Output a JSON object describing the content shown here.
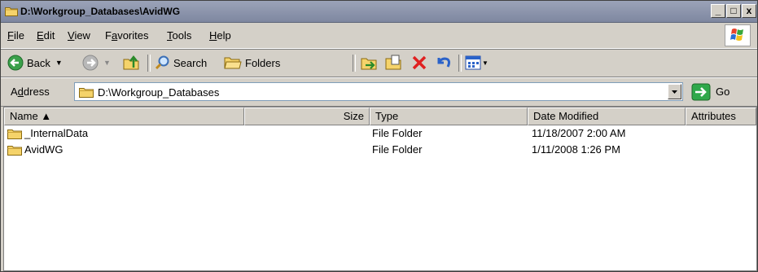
{
  "window": {
    "title": "D:\\Workgroup_Databases\\AvidWG",
    "controls": {
      "minimize": "_",
      "maximize": "□",
      "close": "x"
    }
  },
  "menubar": {
    "items": [
      {
        "label": "File",
        "accel": "F",
        "rest": "ile"
      },
      {
        "label": "Edit",
        "accel": "E",
        "rest": "dit"
      },
      {
        "label": "View",
        "accel": "V",
        "rest": "iew"
      },
      {
        "label": "Favorites",
        "pre": "F",
        "accel": "a",
        "rest": "vorites"
      },
      {
        "label": "Tools",
        "accel": "T",
        "rest": "ools"
      },
      {
        "label": "Help",
        "accel": "H",
        "rest": "elp"
      }
    ]
  },
  "toolbar": {
    "back_label": "Back",
    "search_label": "Search",
    "folders_label": "Folders",
    "icons": [
      "back-icon",
      "forward-icon",
      "up-folder-icon",
      "search-icon",
      "folders-icon",
      "move-to-icon",
      "copy-to-icon",
      "delete-icon",
      "undo-icon",
      "views-icon"
    ]
  },
  "address": {
    "label_pre": "A",
    "label_accel": "d",
    "label_rest": "dress",
    "value": "D:\\Workgroup_Databases",
    "go_label": "Go"
  },
  "columns": [
    {
      "label": "Name ▲"
    },
    {
      "label": "Size"
    },
    {
      "label": "Type"
    },
    {
      "label": "Date Modified"
    },
    {
      "label": "Attributes"
    }
  ],
  "files": [
    {
      "name": "_InternalData",
      "size": "",
      "type": "File Folder",
      "date": "11/18/2007 2:00 AM",
      "attributes": ""
    },
    {
      "name": "AvidWG",
      "size": "",
      "type": "File Folder",
      "date": "1/11/2008 1:26 PM",
      "attributes": ""
    }
  ],
  "colors": {
    "folder": "#f5d36a",
    "titlebar": "#8a93aa",
    "go_green": "#2fa84a",
    "delete_red": "#e02020"
  }
}
